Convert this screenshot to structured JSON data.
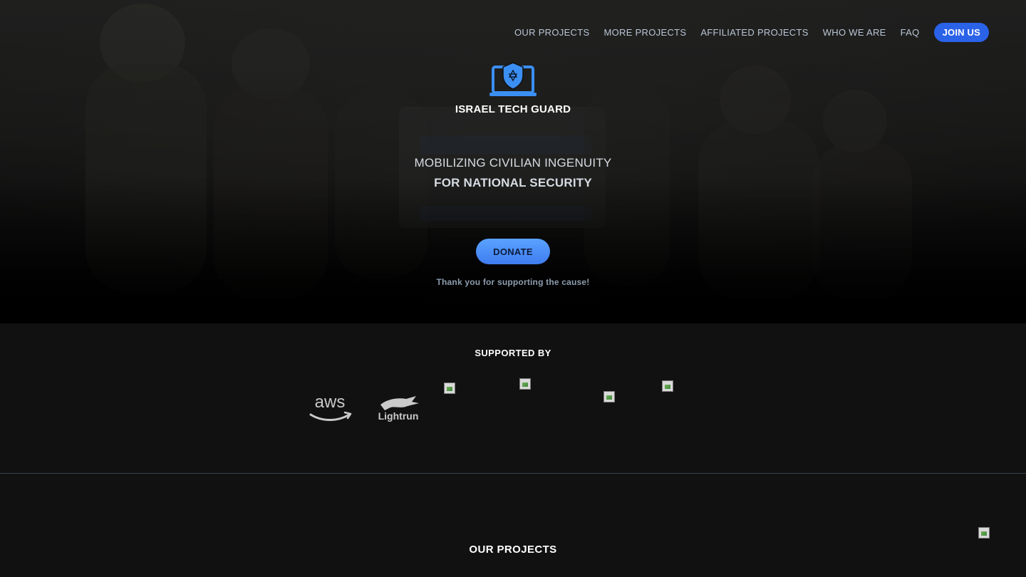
{
  "nav": {
    "links": [
      "OUR PROJECTS",
      "MORE PROJECTS",
      "AFFILIATED PROJECTS",
      "WHO WE ARE",
      "FAQ"
    ],
    "join_label": "JOIN US"
  },
  "hero": {
    "brand": "ISRAEL TECH GUARD",
    "tagline_line1": "MOBILIZING CIVILIAN INGENUITY",
    "tagline_line2": "FOR NATIONAL SECURITY",
    "donate_label": "DONATE",
    "thanks": "Thank you for supporting the cause!"
  },
  "supported": {
    "title": "SUPPORTED BY",
    "sponsors": [
      "aws",
      "Lightrun"
    ]
  },
  "projects": {
    "title": "OUR PROJECTS"
  },
  "colors": {
    "accent": "#2a62e8",
    "donate": "#4a8df8",
    "logo_blue": "#3b8ff2",
    "background": "#111112",
    "nav_text": "#b9c6d6"
  },
  "icons": {
    "logo": "laptop-shield-star-of-david-icon",
    "broken_image": "broken-image-icon"
  }
}
